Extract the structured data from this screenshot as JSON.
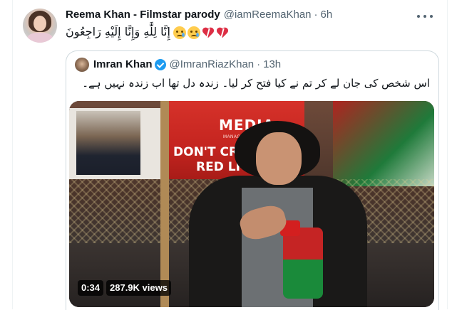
{
  "tweet": {
    "author_name": "Reema Khan - Filmstar parody",
    "handle": "@iamReemaKhan",
    "separator": "·",
    "time": "6h",
    "text": "إِنَّا لِلَّٰهِ وَإِنَّا إِلَيْهِ رَاجِعُونَ",
    "emojis": [
      "sad-but-relieved-face",
      "sad-but-relieved-face",
      "broken-heart",
      "broken-heart"
    ]
  },
  "quoted_tweet": {
    "author_name": "Imran Khan",
    "verified": true,
    "handle": "@ImranRiazKhan",
    "separator": "·",
    "time": "13h",
    "text": "اس شخص کی جان لے کر تم نے کیا فتح کر لیا۔ زندہ دل تھا اب زندہ نہیں ہے۔",
    "video": {
      "duration": "0:34",
      "views": "287.9K views",
      "scene_text": {
        "media": "MEDIA",
        "media_sub": "MANAGEMENT CELL",
        "dont": "DON'T CROSS",
        "red": "RED LI"
      }
    }
  },
  "colors": {
    "text_primary": "#0f1419",
    "text_secondary": "#536471",
    "verified_blue": "#1d9bf0",
    "border": "#cfd9de"
  }
}
